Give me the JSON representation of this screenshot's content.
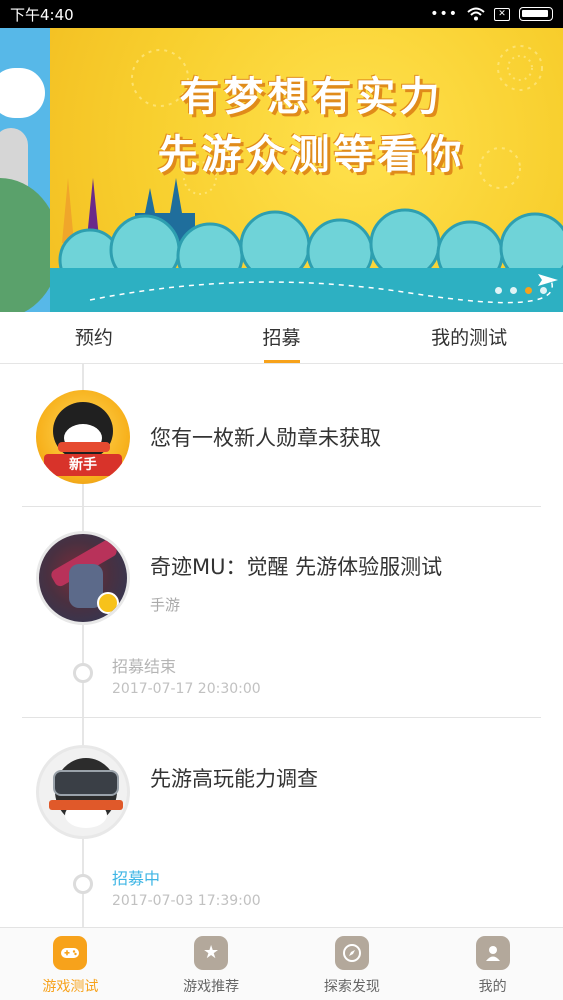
{
  "status_bar": {
    "time": "下午4:40"
  },
  "banner": {
    "line1": "有梦想有实力",
    "line2": "先游众测等看你",
    "page_count": 4,
    "active_page": 3
  },
  "tabs": [
    {
      "label": "预约",
      "active": false
    },
    {
      "label": "招募",
      "active": true
    },
    {
      "label": "我的测试",
      "active": false
    }
  ],
  "items": [
    {
      "title": "您有一枚新人勋章未获取",
      "avatar_label": "新手"
    },
    {
      "title": "奇迹MU：觉醒 先游体验服测试",
      "sub": "手游",
      "status": "招募结束",
      "time": "2017-07-17 20:30:00"
    },
    {
      "title": "先游高玩能力调查",
      "status": "招募中",
      "time": "2017-07-03 17:39:00"
    }
  ],
  "bottom_nav": [
    {
      "label": "游戏测试",
      "icon": "gamepad-icon",
      "active": true
    },
    {
      "label": "游戏推荐",
      "icon": "star-icon",
      "active": false
    },
    {
      "label": "探索发现",
      "icon": "compass-icon",
      "active": false
    },
    {
      "label": "我的",
      "icon": "user-icon",
      "active": false
    }
  ],
  "colors": {
    "accent": "#f7a21b",
    "live_status": "#3fb6e5"
  }
}
